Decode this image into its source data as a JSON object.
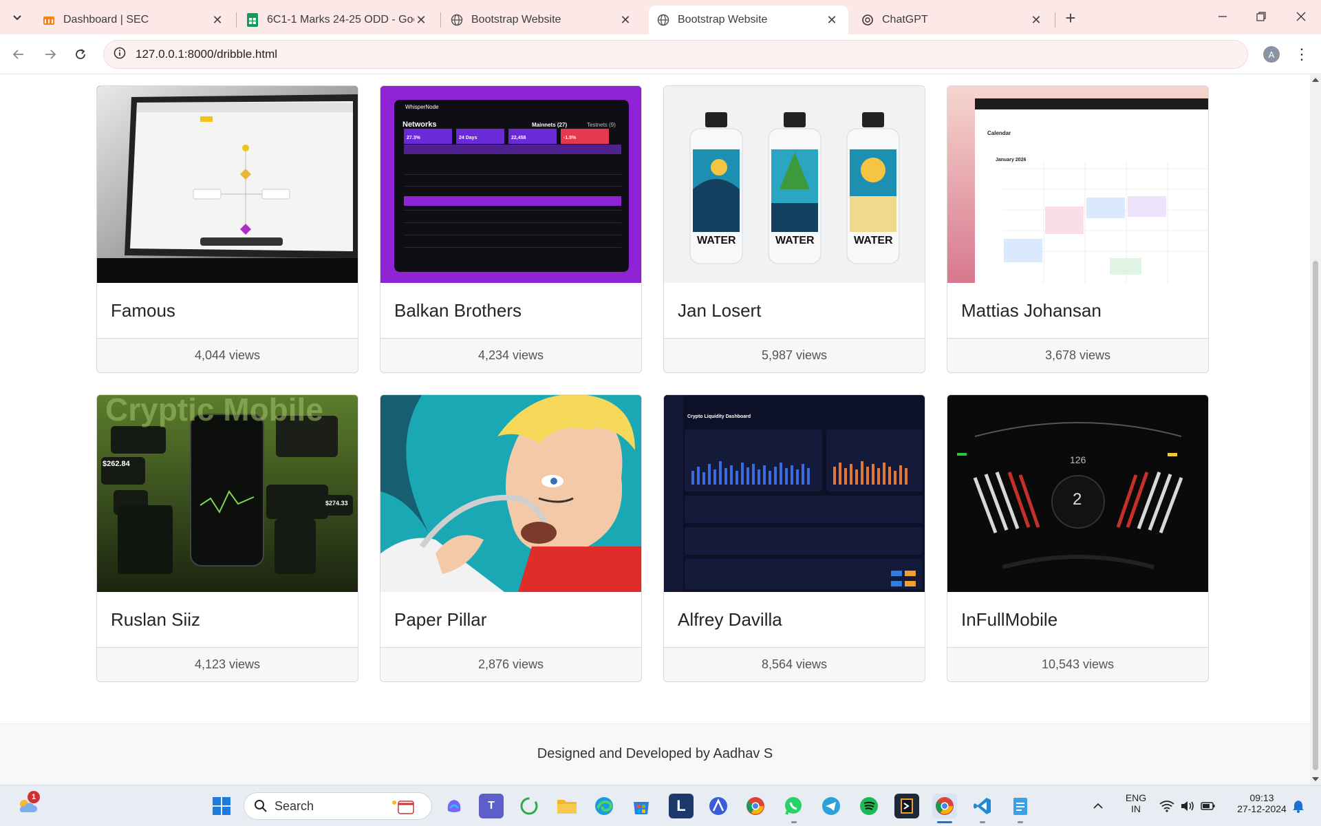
{
  "browser": {
    "tabs": [
      {
        "title": "Dashboard | SEC",
        "favicon": "moodle-icon"
      },
      {
        "title": "6C1-1 Marks 24-25 ODD - Goo",
        "favicon": "sheets-icon"
      },
      {
        "title": "Bootstrap Website",
        "favicon": "globe-icon"
      },
      {
        "title": "Bootstrap Website",
        "favicon": "globe-icon"
      },
      {
        "title": "ChatGPT",
        "favicon": "chatgpt-icon"
      }
    ],
    "url": "127.0.0.1:8000/dribble.html",
    "profile_initial": "A"
  },
  "cards": [
    {
      "title": "Famous",
      "views": "4,044 views"
    },
    {
      "title": "Balkan Brothers",
      "views": "4,234 views"
    },
    {
      "title": "Jan Losert",
      "views": "5,987 views"
    },
    {
      "title": "Mattias Johansan",
      "views": "3,678 views"
    },
    {
      "title": "Ruslan Siiz",
      "views": "4,123 views"
    },
    {
      "title": "Paper Pillar",
      "views": "2,876 views"
    },
    {
      "title": "Alfrey Davilla",
      "views": "8,564 views"
    },
    {
      "title": "InFullMobile",
      "views": "10,543 views"
    }
  ],
  "thumbs": {
    "balkan": {
      "logo": "WhisperNode",
      "heading": "Networks",
      "mainnets": "Mainnets (27)",
      "testnets": "Testnets (9)",
      "stat1": "27.3%",
      "stat2": "24 Days",
      "stat3": "22,458",
      "stat4": "-1.5%"
    },
    "jan": {
      "bottle_label": "WATER"
    },
    "mattias": {
      "heading": "Calendar",
      "month": "January 2026"
    },
    "ruslan": {
      "banner": "Cryptic Mobile",
      "amount1": "$262.84",
      "amount2": "$274.33"
    },
    "alfrey": {
      "heading": "Crypto Liquidity Dashboard"
    },
    "infull": {
      "speed": "126",
      "gear": "2"
    }
  },
  "footer": {
    "text": "Designed and Developed by Aadhav S"
  },
  "taskbar": {
    "weather_badge": "1",
    "search_label": "Search",
    "lang_top": "ENG",
    "lang_bottom": "IN",
    "time": "09:13",
    "date": "27-12-2024"
  }
}
